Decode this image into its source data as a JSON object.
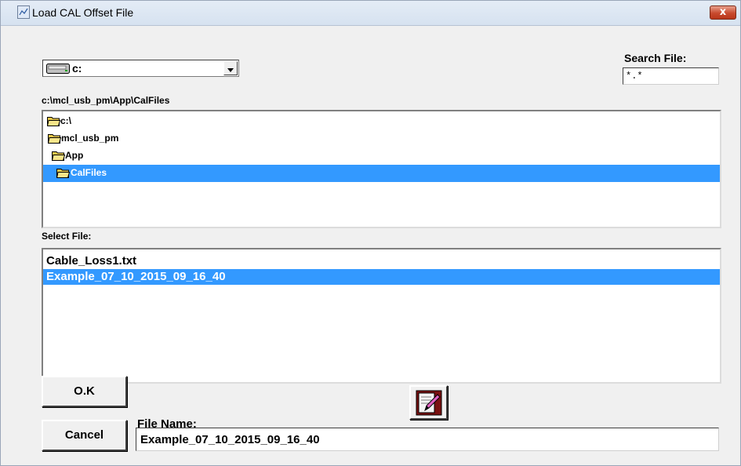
{
  "window": {
    "title": "Load CAL Offset File",
    "close_label": "x"
  },
  "drive": {
    "selected": "c:"
  },
  "search": {
    "label": "Search File:",
    "value": "*.*"
  },
  "current_path": "c:\\mcl_usb_pm\\App\\CalFiles",
  "directories": [
    "c:\\",
    "mcl_usb_pm",
    "App",
    "CalFiles"
  ],
  "select_file_label": "Select File:",
  "files": [
    "Cable_Loss1.txt",
    "Example_07_10_2015_09_16_40"
  ],
  "buttons": {
    "ok": "O.K",
    "cancel": "Cancel"
  },
  "file_name": {
    "label": "File Name:",
    "value": "Example_07_10_2015_09_16_40"
  },
  "colors": {
    "selection": "#3399ff",
    "dialog_bg": "#f0f0f0",
    "folder": "#e8c84a"
  },
  "icons": {
    "drive": "drive-icon",
    "folder": "folder-icon",
    "edit": "edit-file-icon"
  }
}
